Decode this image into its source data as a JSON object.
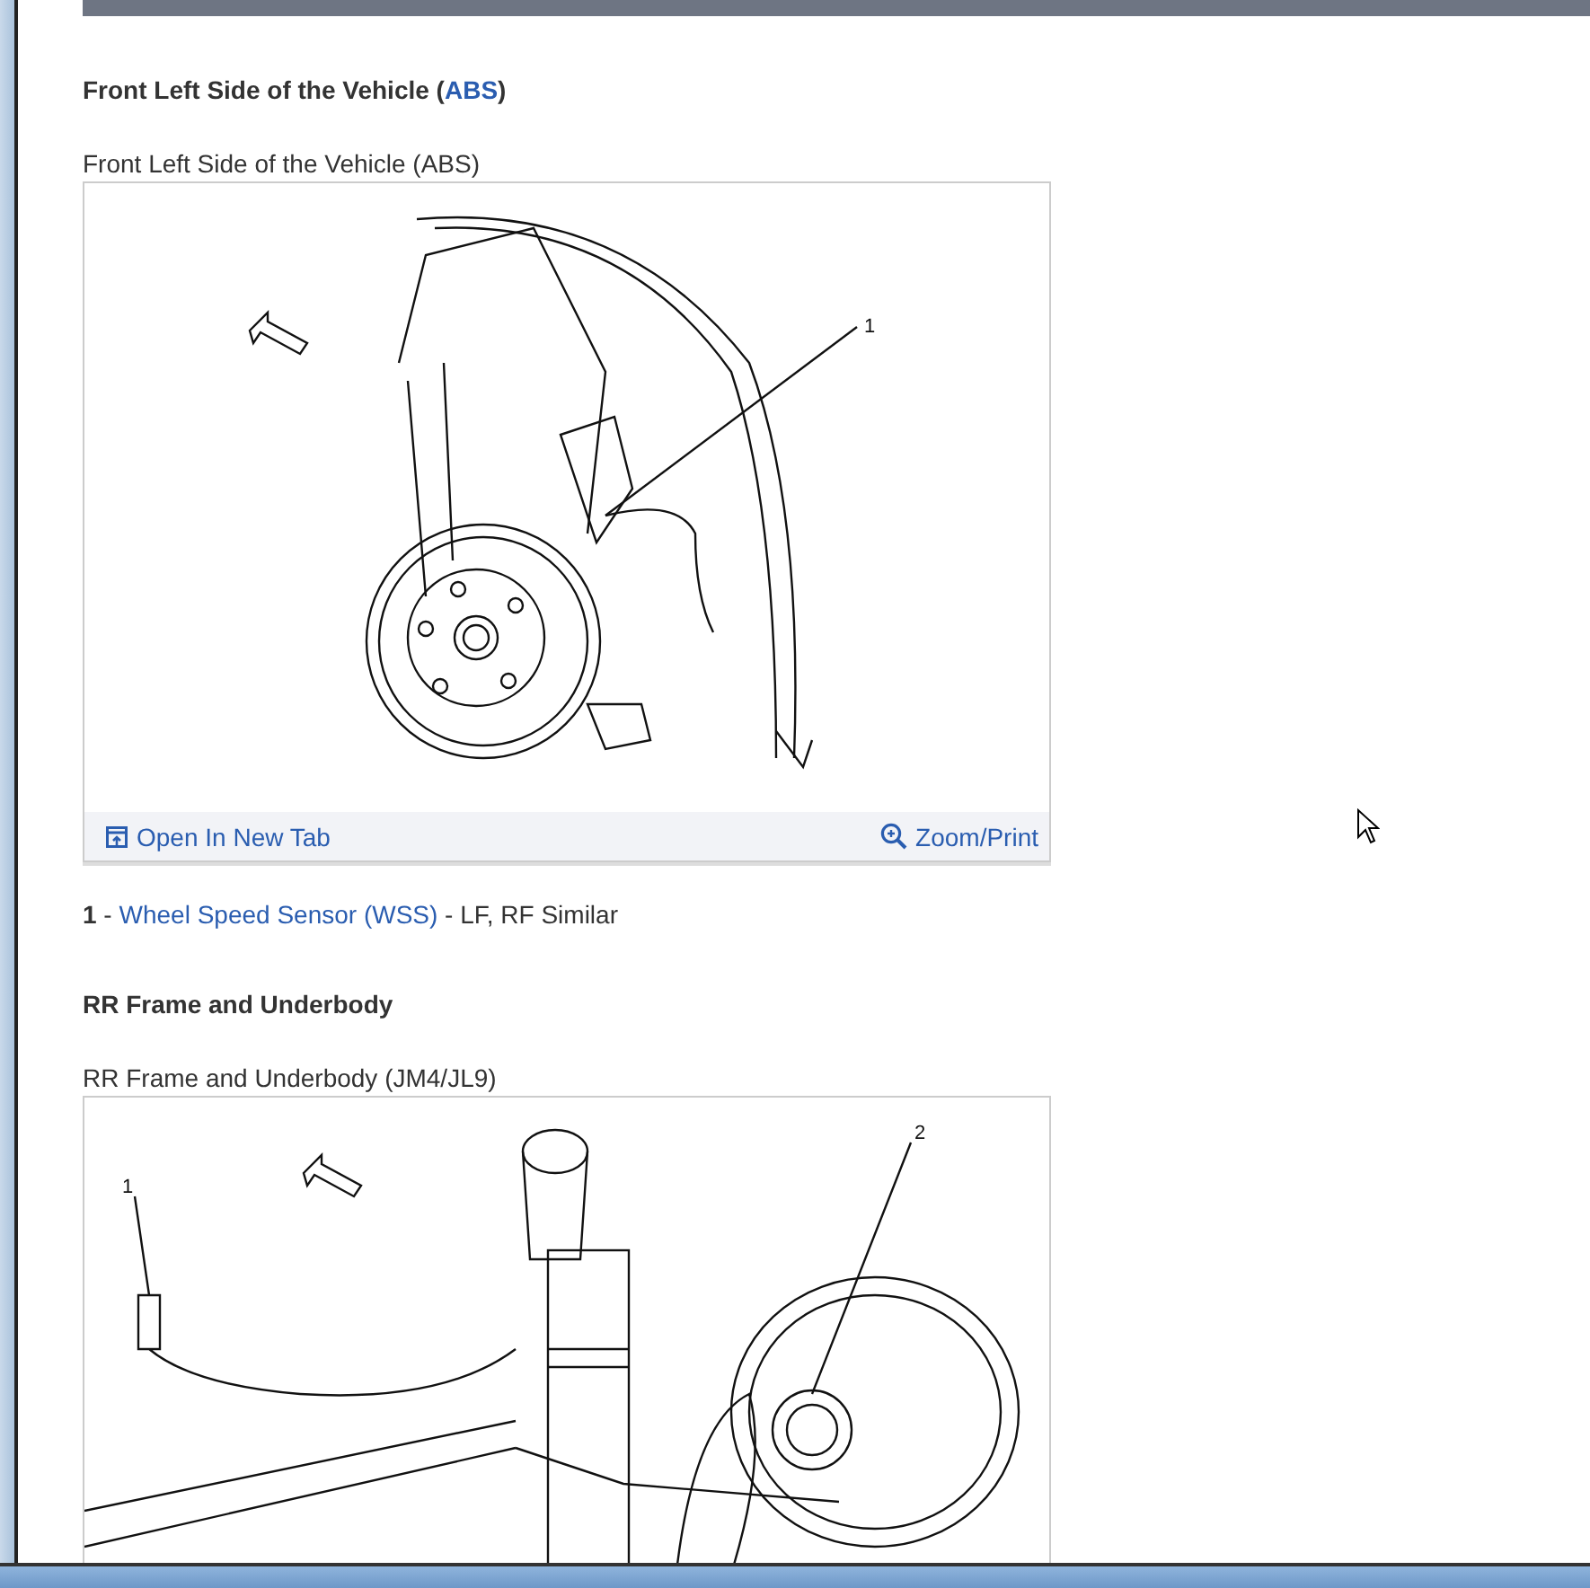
{
  "sections": [
    {
      "heading": {
        "before": "Front Left Side of the Vehicle (",
        "link": "ABS",
        "after": ")"
      },
      "figure": {
        "caption": "Front Left Side of the Vehicle (ABS)",
        "kind": "wheel-hub",
        "callouts": [
          "1"
        ],
        "footer": {
          "open_tab": "Open In New Tab",
          "zoom": "Zoom/Print"
        }
      },
      "legend": [
        {
          "number": "1",
          "separator": "-",
          "link": "Wheel Speed Sensor (WSS)",
          "text": "- LF, RF Similar"
        }
      ]
    },
    {
      "heading": {
        "before": "RR Frame and Underbody"
      },
      "figure": {
        "caption": "RR Frame and Underbody (JM4/JL9)",
        "kind": "underbody",
        "callouts": [
          "1",
          "2"
        ]
      }
    }
  ]
}
